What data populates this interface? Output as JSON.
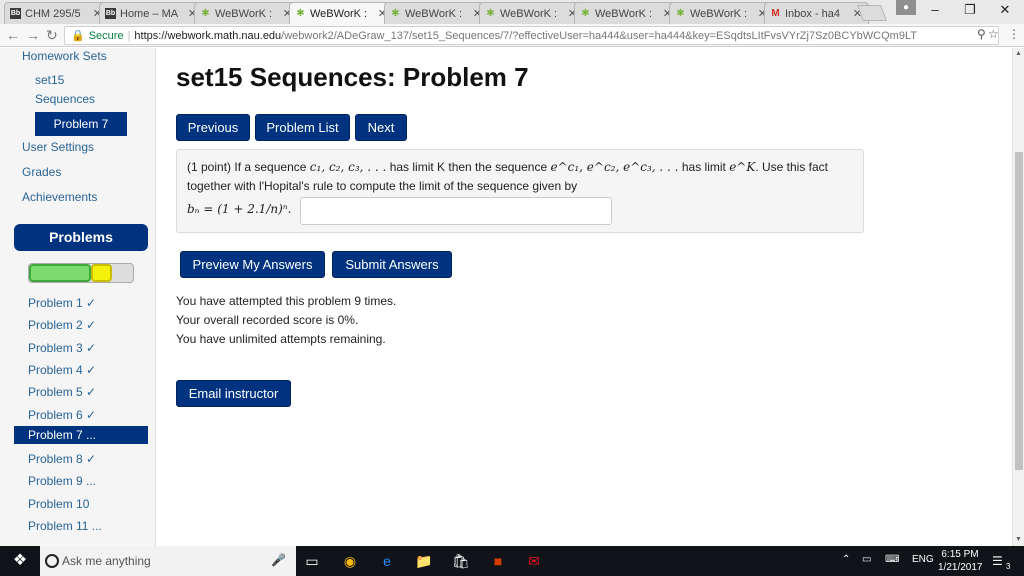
{
  "browser": {
    "tabs": [
      {
        "title": "CHM 295/5",
        "icon": "blackboard-icon",
        "active": false
      },
      {
        "title": "Home – MA",
        "icon": "blackboard-icon",
        "active": false
      },
      {
        "title": "WeBWorK :",
        "icon": "webwork-icon",
        "active": false
      },
      {
        "title": "WeBWorK :",
        "icon": "webwork-icon",
        "active": true
      },
      {
        "title": "WeBWorK :",
        "icon": "webwork-icon",
        "active": false
      },
      {
        "title": "WeBWorK :",
        "icon": "webwork-icon",
        "active": false
      },
      {
        "title": "WeBWorK :",
        "icon": "webwork-icon",
        "active": false
      },
      {
        "title": "WeBWorK :",
        "icon": "webwork-icon",
        "active": false
      },
      {
        "title": "Inbox - ha4",
        "icon": "gmail-icon",
        "active": false
      }
    ],
    "secure_label": "Secure",
    "url_host": "https://webwork.math.nau.edu",
    "url_path": "/webwork2/ADeGraw_137/set15_Sequences/7/?effectiveUser=ha444&user=ha444&key=ESqdtsLItFvsVYrZj7Sz0BCYbWCQm9LT"
  },
  "sidebar": {
    "homework_sets": "Homework Sets",
    "set_name_1": "set15",
    "set_name_2": "Sequences",
    "current_problem": "Problem 7",
    "user_settings": "User Settings",
    "grades": "Grades",
    "achievements": "Achievements",
    "problems_heading": "Problems",
    "progress": {
      "correct_fraction": 0.6,
      "attempted_fraction": 0.2
    },
    "problem_list": [
      "Problem 1 ✓",
      "Problem 2 ✓",
      "Problem 3 ✓",
      "Problem 4 ✓",
      "Problem 5 ✓",
      "Problem 6 ✓",
      "Problem 7 ...",
      "Problem 8 ✓",
      "Problem 9 ...",
      "Problem 10",
      "Problem 11 ..."
    ]
  },
  "main": {
    "title": "set15 Sequences: Problem 7",
    "nav": {
      "previous": "Previous",
      "problem_list": "Problem List",
      "next": "Next"
    },
    "problem": {
      "points": "(1 point)",
      "text_1": "If a sequence",
      "seq": "c₁, c₂, c₃, . . .",
      "text_2": "has limit K then the sequence",
      "exp_seq": "e^c₁, e^c₂, e^c₃, . . .",
      "text_3": "has limit",
      "limit": "e^K",
      "text_4": ". Use this fact",
      "line2": "together with l'Hopital's rule to compute the limit of the sequence given by",
      "formula": "bₙ = (1 + 2.1/n)ⁿ.",
      "answer_value": ""
    },
    "actions": {
      "preview": "Preview My Answers",
      "submit": "Submit Answers"
    },
    "status": [
      "You have attempted this problem 9 times.",
      "Your overall recorded score is 0%.",
      "You have unlimited attempts remaining."
    ],
    "email": "Email instructor"
  },
  "taskbar": {
    "search_placeholder": "Ask me anything",
    "language": "ENG",
    "time": "6:15 PM",
    "date": "1/21/2017",
    "notifications": "3"
  }
}
